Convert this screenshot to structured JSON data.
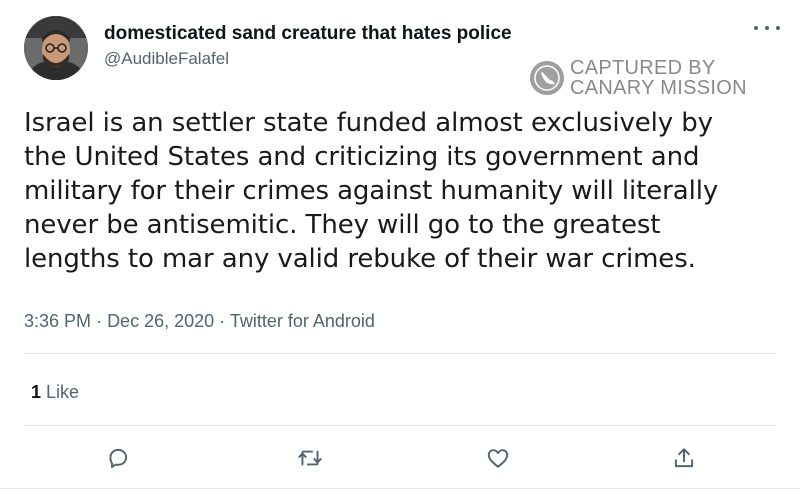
{
  "author": {
    "display_name": "domesticated sand creature that hates police",
    "handle": "@AudibleFalafel"
  },
  "watermark": {
    "line1": "CAPTURED BY",
    "line2": "CANARY MISSION"
  },
  "tweet": {
    "lines": [
      "Israel is an settler state funded almost exclusively by",
      "the United States and criticizing its government and",
      "military for their crimes against humanity will literally",
      "never be antisemitic. They will go to the greatest",
      "lengths to mar any valid rebuke of their war crimes."
    ],
    "time": "3:36 PM",
    "date": "Dec 26, 2020",
    "source": "Twitter for Android",
    "separator": "·"
  },
  "engagement": {
    "like_count": "1",
    "like_label": "Like"
  },
  "actions": [
    "reply-icon",
    "retweet-icon",
    "like-icon",
    "share-icon"
  ],
  "colors": {
    "secondary_text": "#536471",
    "primary_text": "#0f1419",
    "divider": "#e3e7ea"
  }
}
